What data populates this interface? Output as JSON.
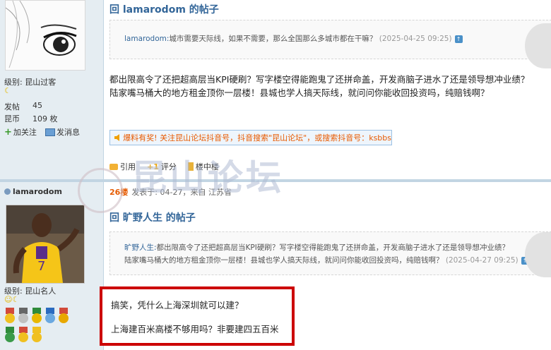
{
  "post1": {
    "user_rank": "级别: 昆山过客",
    "stats": [
      {
        "key": "发帖",
        "value": "45"
      },
      {
        "key": "昆币",
        "value": "109 枚"
      }
    ],
    "follow_label": "加关注",
    "message_label": "发消息",
    "reply_title": "回 lamarodom 的帖子",
    "quote_author": "lamarodom:",
    "quote_text": "城市需要天际线，如果不需要，那么全国那么多城市都在干嘛？",
    "quote_date": "(2025-04-25 09:25)",
    "body_lines": [
      "都出限高令了还把超高层当KPI硬刷？写字楼空得能跑鬼了还拼命盖，开发商脑子进水了还是领导想冲业绩？",
      "陆家嘴马桶大的地方租金顶你一层楼！县城也学人搞天际线，就问问你能收回投资吗，纯赔钱啊？"
    ],
    "promo_text": "爆料有奖! 关注昆山论坛抖音号，抖音搜索\"昆山论坛\"，或搜索抖音号：ksbbs",
    "actions": [
      "引用",
      "评分",
      "楼中楼"
    ]
  },
  "post2": {
    "username": "lamarodom",
    "floor_number": "26楼",
    "floor_meta": "发表于: 04-27，来自 江苏省",
    "user_rank": "级别: 昆山名人",
    "reply_title": "回 旷野人生 的帖子",
    "quote_author": "旷野人生:",
    "quote_line1": "都出限高令了还把超高层当KPI硬刷？写字楼空得能跑鬼了还拼命盖，开发商脑子进水了还是领导想冲业绩？",
    "quote_line2": "陆家嘴马桶大的地方租金顶你一层楼！县城也学人搞天际线，就问问你能收回投资吗，纯赔钱啊？",
    "quote_date": "(2025-04-27 09:25)",
    "body_lines": [
      "搞笑，凭什么上海深圳就可以建？",
      "上海建百米高楼不够用吗？非要建四五百米"
    ]
  },
  "watermark_text": "昆山论坛",
  "colors": {
    "sidebar_bg": "#e5edf2",
    "title_blue": "#336699",
    "highlight_red": "#cc0000",
    "promo_orange": "#e85a00"
  }
}
